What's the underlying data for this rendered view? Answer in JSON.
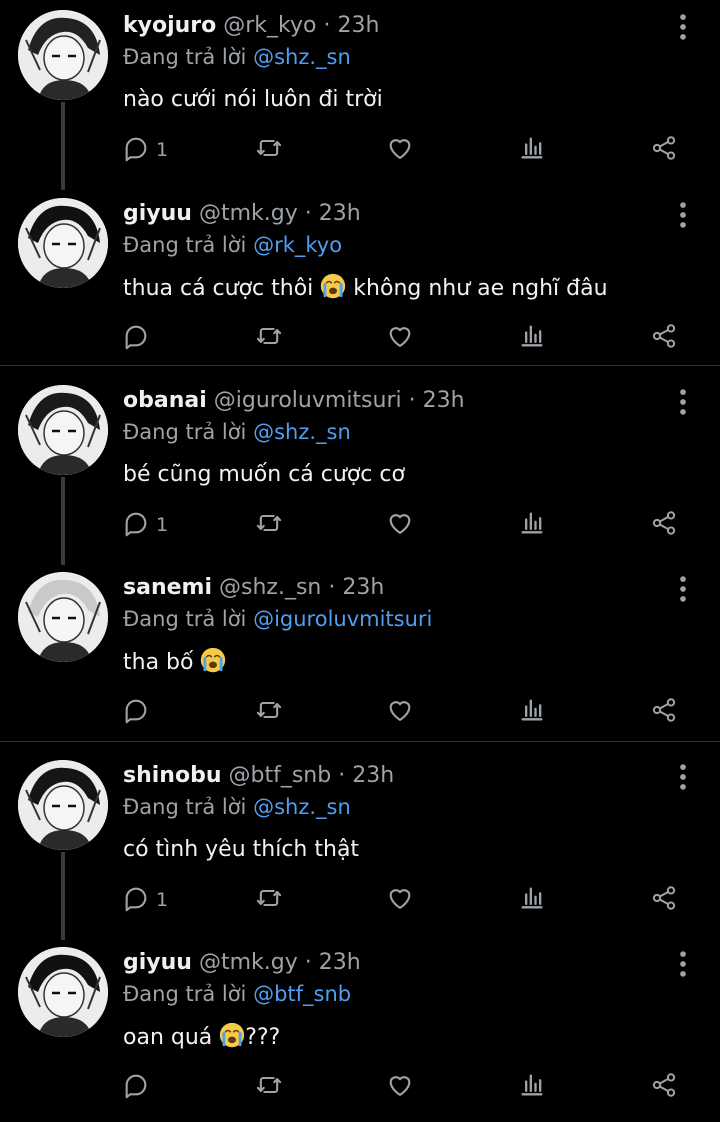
{
  "reply_prefix": "Đang trả lời",
  "sep": "·",
  "tweets": [
    {
      "name": "kyojuro",
      "handle": "@rk_kyo",
      "time": "23h",
      "reply_to": "@shz._sn",
      "text": "nào cưới nói luôn đi trời",
      "text_after": "",
      "reply_count": "1",
      "avatar": "kyojuro-avatar"
    },
    {
      "name": "giyuu",
      "handle": "@tmk.gy",
      "time": "23h",
      "reply_to": "@rk_kyo",
      "text": "thua cá cược thôi",
      "text_after": "không như ae nghĩ đâu",
      "reply_count": "",
      "avatar": "giyuu-avatar",
      "emoji": "loudly-crying-face"
    },
    {
      "name": "obanai",
      "handle": "@iguroluvmitsuri",
      "time": "23h",
      "reply_to": "@shz._sn",
      "text": "bé cũng muốn cá cược cơ",
      "text_after": "",
      "reply_count": "1",
      "avatar": "obanai-avatar"
    },
    {
      "name": "sanemi",
      "handle": "@shz._sn",
      "time": "23h",
      "reply_to": "@iguroluvmitsuri",
      "text": "tha bố",
      "text_after": "",
      "reply_count": "",
      "avatar": "sanemi-avatar",
      "emoji": "loudly-crying-face"
    },
    {
      "name": "shinobu",
      "handle": "@btf_snb",
      "time": "23h",
      "reply_to": "@shz._sn",
      "text": "có tình yêu thích thật",
      "text_after": "",
      "reply_count": "1",
      "avatar": "shinobu-avatar"
    },
    {
      "name": "giyuu",
      "handle": "@tmk.gy",
      "time": "23h",
      "reply_to": "@btf_snb",
      "text": "oan quá",
      "text_after": "???",
      "reply_count": "",
      "avatar": "giyuu-avatar",
      "emoji": "loudly-crying-face"
    }
  ],
  "colors": {
    "background": "#000000",
    "muted": "#9ea3a8",
    "link": "#4f9ff0",
    "divider": "#2f3336"
  }
}
